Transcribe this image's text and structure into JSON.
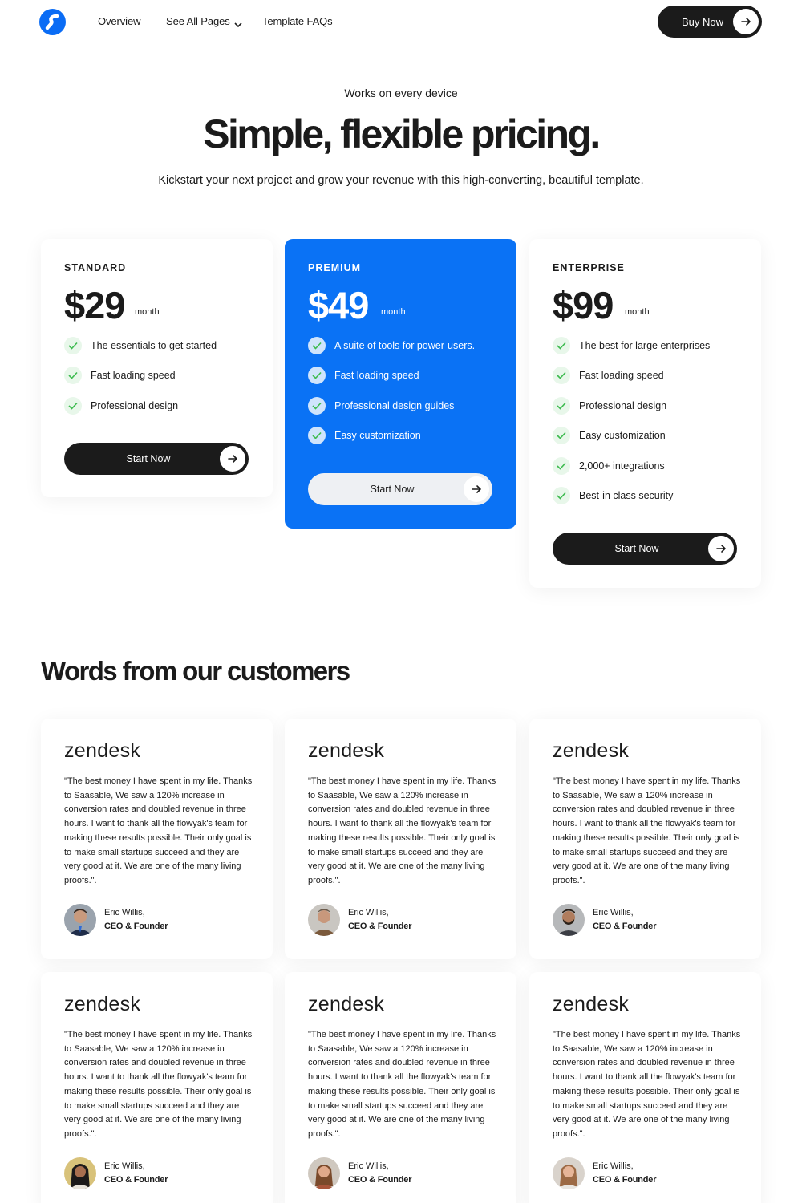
{
  "nav": {
    "links": [
      "Overview",
      "See All Pages",
      "Template FAQs"
    ],
    "buy_label": "Buy Now"
  },
  "hero": {
    "eyebrow": "Works on every device",
    "title": "Simple, flexible pricing.",
    "subtitle": "Kickstart your next project and grow your revenue with this high-converting, beautiful template."
  },
  "plans": [
    {
      "tier": "STANDARD",
      "price": "$29",
      "period": "month",
      "features": [
        "The essentials to get started",
        "Fast loading speed",
        "Professional design"
      ],
      "cta": "Start Now"
    },
    {
      "tier": "PREMIUM",
      "price": "$49",
      "period": "month",
      "features": [
        "A suite of tools for power-users.",
        "Fast loading speed",
        "Professional design guides",
        "Easy customization"
      ],
      "cta": "Start Now"
    },
    {
      "tier": "ENTERPRISE",
      "price": "$99",
      "period": "month",
      "features": [
        "The best for large enterprises",
        "Fast loading speed",
        "Professional design",
        "Easy customization",
        "2,000+ integrations",
        "Best-in class security"
      ],
      "cta": "Start Now"
    }
  ],
  "testimonials": {
    "title": "Words from our customers",
    "items": [
      {
        "brand": "zendesk",
        "quote": "\"The best money I have spent in my life. Thanks to Saasable, We saw a 120% increase in conversion rates and doubled revenue in three hours. I want to thank all the flowyak's team for making these results possible. Their only goal is to make small startups succeed and they are very good at it. We are one of the many living proofs.\".",
        "name": "Eric Willis,",
        "role": "CEO & Founder"
      },
      {
        "brand": "zendesk",
        "quote": "\"The best money I have spent in my life. Thanks to Saasable, We saw a 120% increase in conversion rates and doubled revenue in three hours. I want to thank all the flowyak's team for making these results possible. Their only goal is to make small startups succeed and they are very good at it. We are one of the many living proofs.\".",
        "name": "Eric Willis,",
        "role": "CEO & Founder"
      },
      {
        "brand": "zendesk",
        "quote": "\"The best money I have spent in my life. Thanks to Saasable, We saw a 120% increase in conversion rates and doubled revenue in three hours. I want to thank all the flowyak's team for making these results possible. Their only goal is to make small startups succeed and they are very good at it. We are one of the many living proofs.\".",
        "name": "Eric Willis,",
        "role": "CEO & Founder"
      },
      {
        "brand": "zendesk",
        "quote": "\"The best money I have spent in my life. Thanks to Saasable, We saw a 120% increase in conversion rates and doubled revenue in three hours. I want to thank all the flowyak's team for making these results possible. Their only goal is to make small startups succeed and they are very good at it. We are one of the many living proofs.\".",
        "name": "Eric Willis,",
        "role": "CEO & Founder"
      },
      {
        "brand": "zendesk",
        "quote": "\"The best money I have spent in my life. Thanks to Saasable, We saw a 120% increase in conversion rates and doubled revenue in three hours. I want to thank all the flowyak's team for making these results possible. Their only goal is to make small startups succeed and they are very good at it. We are one of the many living proofs.\".",
        "name": "Eric Willis,",
        "role": "CEO & Founder"
      },
      {
        "brand": "zendesk",
        "quote": "\"The best money I have spent in my life. Thanks to Saasable, We saw a 120% increase in conversion rates and doubled revenue in three hours. I want to thank all the flowyak's team for making these results possible. Their only goal is to make small startups succeed and they are very good at it. We are one of the many living proofs.\".",
        "name": "Eric Willis,",
        "role": "CEO & Founder"
      }
    ]
  },
  "colors": {
    "accent": "#0a72f5",
    "dark": "#1b1b1b",
    "check_bg": "#e8f7ea",
    "check_green": "#3dbb4f"
  },
  "icons": {
    "logo": "brand-logo-icon",
    "dropdown": "chevron-down-icon",
    "arrow": "arrow-right-icon",
    "check": "check-icon"
  }
}
